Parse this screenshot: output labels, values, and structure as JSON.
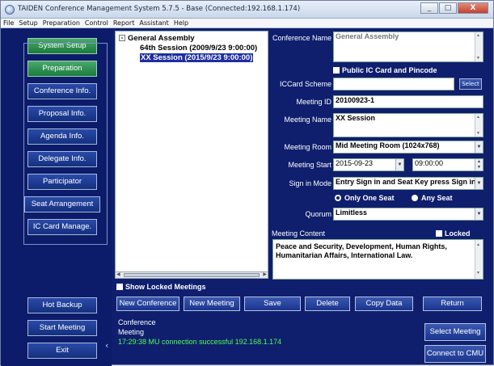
{
  "window": {
    "title": "TAIDEN Conference Management System 5.7.5 - Base (Connected:192.168.1.174)",
    "controls": [
      "_",
      "□",
      "X"
    ]
  },
  "menubar": [
    "File",
    "Setup",
    "Preparation",
    "Control",
    "Report",
    "Assistant",
    "Help"
  ],
  "sidebar": {
    "system_setup": "System Setup",
    "preparation": "Preparation",
    "items": [
      "Conference Info.",
      "Proposal Info.",
      "Agenda Info.",
      "Delegate Info.",
      "Participator",
      "Seat Arrangement",
      "IC Card Manage."
    ],
    "hot_backup": "Hot Backup",
    "start_meeting": "Start Meeting",
    "exit": "Exit"
  },
  "tree": {
    "root": "General Assembly",
    "root_toggle": "-",
    "children": [
      "64th Session (2009/9/23 9:00:00)",
      "XX Session (2015/9/23 9:00:00)"
    ],
    "selected_index": 1
  },
  "show_locked": "Show Locked Meetings",
  "form": {
    "conference_name_label": "Conference Name",
    "conference_name": "General Assembly",
    "public_ic": "Public IC Card and Pincode",
    "iccard_scheme_label": "ICCard Scheme",
    "iccard_scheme": "",
    "select_label": "Select",
    "meeting_id_label": "Meeting ID",
    "meeting_id": "20100923-1",
    "meeting_name_label": "Meeting Name",
    "meeting_name": "XX Session",
    "meeting_room_label": "Meeting Room",
    "meeting_room": "Mid Meeting Room (1024x768)",
    "meeting_start_label": "Meeting Start",
    "meeting_start_date": "2015-09-23",
    "meeting_start_time": "09:00:00",
    "signin_mode_label": "Sign in Mode",
    "signin_mode": "Entry Sign in and Seat Key press Sign in",
    "only_one_seat": "Only One Seat",
    "any_seat": "Any Seat",
    "quorum_label": "Quorum",
    "quorum": "Limitless",
    "meeting_content_label": "Meeting Content",
    "locked_label": "Locked",
    "meeting_content": "Peace and Security, Development, Human Rights, Humanitarian Affairs, International Law."
  },
  "toolbar": [
    "New Conference",
    "New Meeting",
    "Save",
    "Delete",
    "Copy Data",
    "Return"
  ],
  "status": {
    "line1": "Conference",
    "line2": "Meeting",
    "line3": "17:29:38 MU connection successful 192.168.1.174"
  },
  "right_buttons": {
    "select_meeting": "Select Meeting",
    "connect": "Connect to CMU"
  }
}
